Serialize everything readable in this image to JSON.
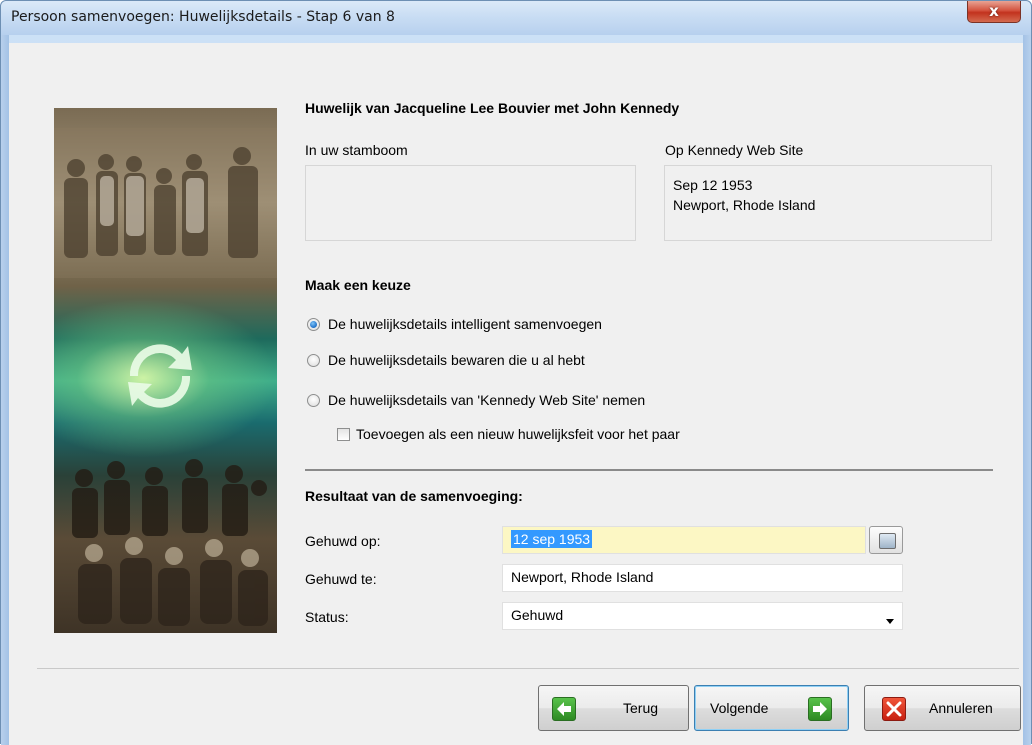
{
  "window": {
    "title": "Persoon samenvoegen: Huwelijksdetails - Stap 6 van 8",
    "close_label": "x"
  },
  "main": {
    "heading": "Huwelijk van Jacqueline Lee Bouvier met John Kennedy",
    "left_column_label": "In uw stamboom",
    "left_column_value": "",
    "right_column_label": "Op Kennedy Web Site",
    "right_column_date": "Sep 12 1953",
    "right_column_place": "Newport, Rhode Island"
  },
  "choice": {
    "heading": "Maak een keuze",
    "options": [
      {
        "label": "De huwelijksdetails intelligent samenvoegen",
        "checked": true
      },
      {
        "label": "De huwelijksdetails bewaren die u al hebt",
        "checked": false
      },
      {
        "label": "De huwelijksdetails van 'Kennedy Web Site' nemen",
        "checked": false
      }
    ],
    "checkbox_label": "Toevoegen als een nieuw huwelijksfeit voor het paar",
    "checkbox_checked": false
  },
  "result": {
    "heading": "Resultaat van de samenvoeging:",
    "married_on_label": "Gehuwd op:",
    "married_on_value": "12 sep 1953",
    "married_at_label": "Gehuwd te:",
    "married_at_value": "Newport, Rhode Island",
    "status_label": "Status:",
    "status_value": "Gehuwd"
  },
  "buttons": {
    "back": "Terug",
    "next": "Volgende",
    "cancel": "Annuleren"
  },
  "colors": {
    "date_field_bg": "#fcf7c4",
    "selection": "#3399ff",
    "nav_icon_green": "#3aa02e",
    "cancel_icon_red": "#d8301a"
  },
  "icons": {
    "close": "close-icon",
    "calendar": "calendar-icon",
    "back": "arrow-left-icon",
    "next": "arrow-right-icon",
    "cancel": "x-icon",
    "sync": "sync-arrows-icon",
    "dropdown": "chevron-down-icon"
  }
}
